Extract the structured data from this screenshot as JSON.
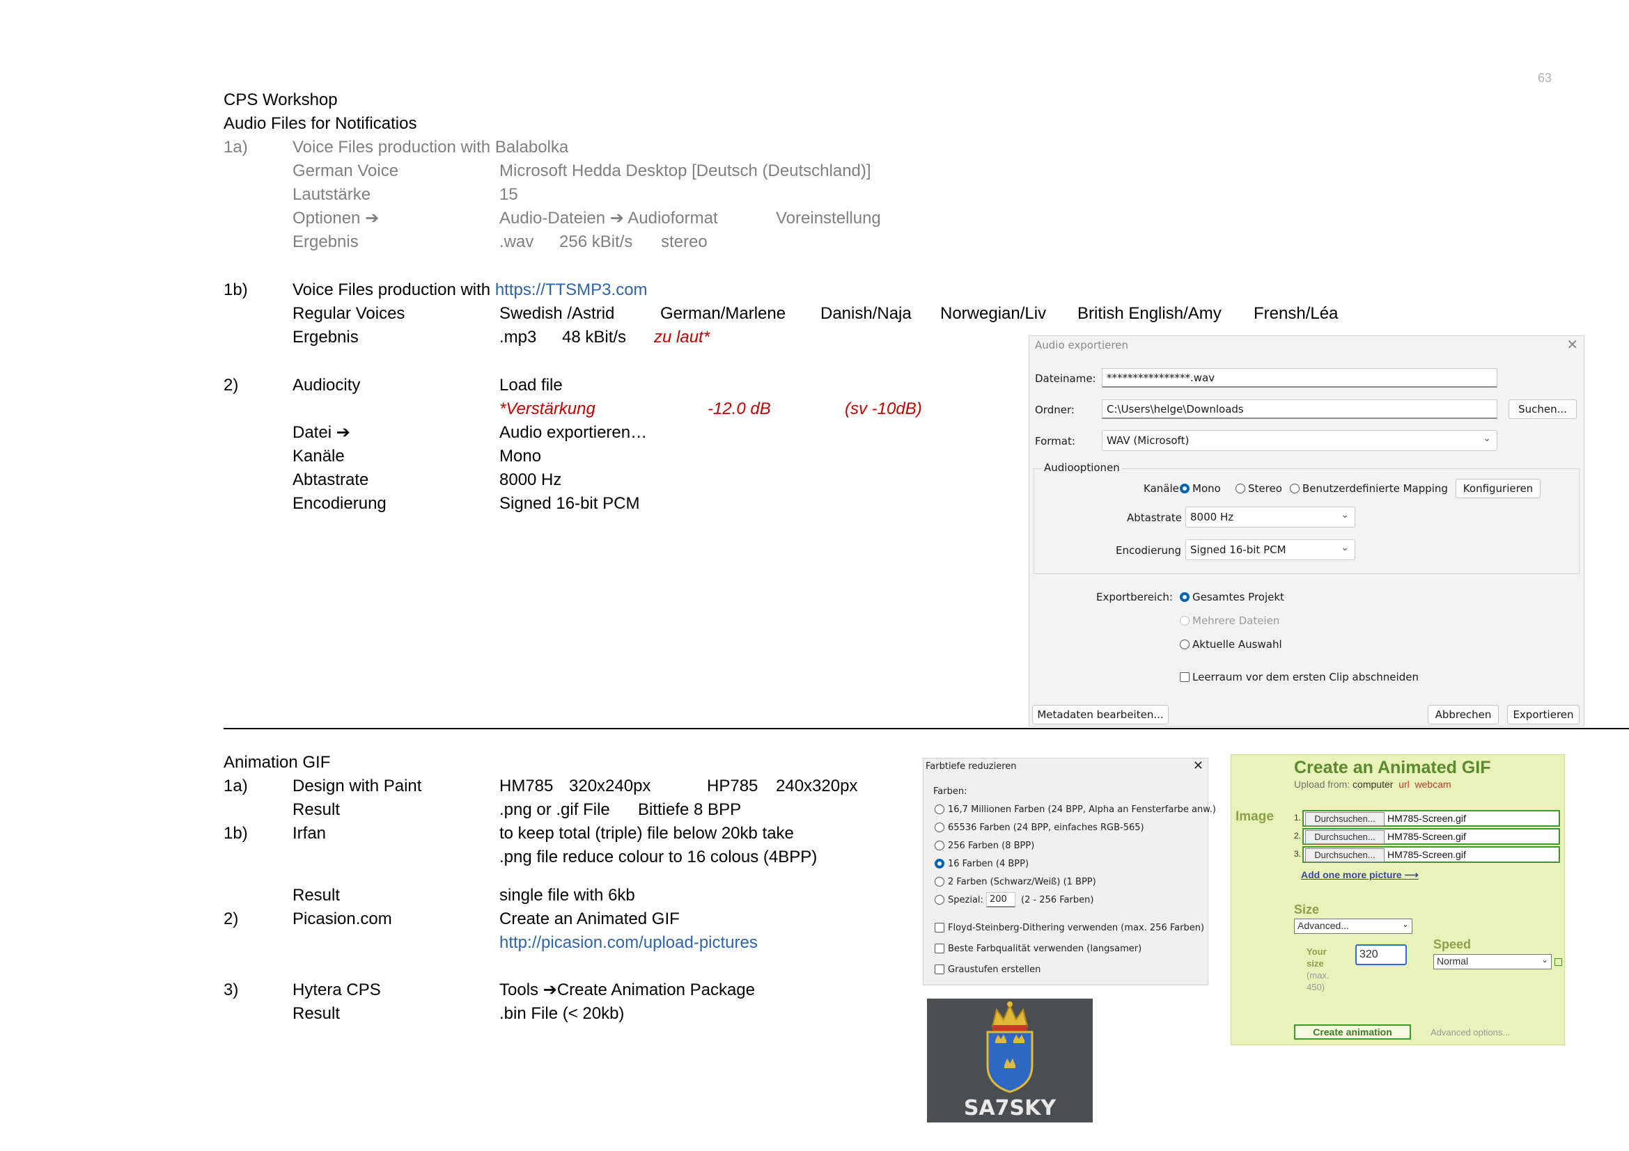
{
  "page_number": "63",
  "header": {
    "title": "CPS Workshop",
    "subtitle": "Audio Files for Notificatios"
  },
  "s1a": {
    "num": "1a)",
    "title": "Voice Files production with Balabolka",
    "german_voice_label": "German Voice",
    "german_voice_value": "Microsoft Hedda Desktop [Deutsch (Deutschland)]",
    "volume_label": "Lautstärke",
    "volume_value": "15",
    "options_label": "Optionen",
    "options_a": "Audio-Dateien",
    "options_b": "Audioformat",
    "options_c": "Voreinstellung",
    "result_label": "Ergebnis",
    "result_a": ".wav",
    "result_b": "256 kBit/s",
    "result_c": "stereo"
  },
  "s1b": {
    "num": "1b)",
    "title_prefix": "Voice Files production with ",
    "link": "https://TTSMP3.com",
    "voices_label": "Regular Voices",
    "voices": [
      "Swedish /Astrid",
      "German/Marlene",
      "Danish/Naja",
      "Norwegian/Liv",
      "British English/Amy",
      "Frensh/Léa"
    ],
    "result_label": "Ergebnis",
    "result_a": ".mp3",
    "result_b": "48 kBit/s",
    "result_note": "zu laut*"
  },
  "s2": {
    "num": "2)",
    "label": "Audiocity",
    "load": "Load file",
    "gain_a": "*Verstärkung",
    "gain_b": "-12.0 dB",
    "gain_c": "(sv -10dB)",
    "file_label": "Datei",
    "file_value": "Audio exportieren…",
    "channels_label": "Kanäle",
    "channels_value": "Mono",
    "rate_label": "Abtastrate",
    "rate_value": "8000 Hz",
    "enc_label": "Encodierung",
    "enc_value": "Signed 16-bit PCM"
  },
  "export_dialog": {
    "title": "Audio exportieren",
    "filename_label": "Dateiname:",
    "filename_value": "****************.wav",
    "folder_label": "Ordner:",
    "folder_value": "C:\\Users\\helge\\Downloads",
    "browse": "Suchen...",
    "format_label": "Format:",
    "format_value": "WAV (Microsoft)",
    "audio_options": "Audiooptionen",
    "channels_label": "Kanäle",
    "mono": "Mono",
    "stereo": "Stereo",
    "custom": "Benutzerdefinierte Mapping",
    "configure": "Konfigurieren",
    "rate_label": "Abtastrate",
    "rate_value": "8000 Hz",
    "enc_label": "Encodierung",
    "enc_value": "Signed 16-bit PCM",
    "range_label": "Exportbereich:",
    "range_all": "Gesamtes Projekt",
    "range_multi": "Mehrere Dateien",
    "range_sel": "Aktuelle Auswahl",
    "trim": "Leerraum vor dem ersten Clip abschneiden",
    "metadata": "Metadaten bearbeiten...",
    "cancel": "Abbrechen",
    "export": "Exportieren"
  },
  "gif": {
    "title": "Animation GIF",
    "r1_num": "1a)",
    "r1_label": "Design with Paint",
    "r1_a": "HM785",
    "r1_b": "320x240px",
    "r1_c": "HP785",
    "r1_d": "240x320px",
    "r2_label": "Result",
    "r2_a": ".png or .gif File",
    "r2_b": "Bittiefe 8 BPP",
    "r3_num": "1b)",
    "r3_label": "Irfan",
    "r3_a": "to keep total (triple) file below 20kb take",
    "r3_b": ".png file reduce colour to 16 colous (4BPP)",
    "r4_label": "Result",
    "r4_a": "single file with 6kb",
    "r5_num": "2)",
    "r5_label": "Picasion.com",
    "r5_a": "Create an Animated GIF",
    "r5_link": "http://picasion.com/upload-pictures",
    "r6_num": "3)",
    "r6_label": "Hytera CPS",
    "r6_a": "Tools",
    "r6_b": "Create Animation Package",
    "r7_label": "Result",
    "r7_a": ".bin File (< 20kb)"
  },
  "farbtiefe": {
    "title": "Farbtiefe reduzieren",
    "colors_label": "Farben:",
    "options": [
      "16,7 Millionen Farben (24 BPP, Alpha an Fensterfarbe anw.)",
      "65536 Farben (24 BPP, einfaches RGB-565)",
      "256 Farben (8 BPP)",
      "16 Farben (4 BPP)",
      "2 Farben (Schwarz/Weiß) (1 BPP)"
    ],
    "special_label": "Spezial:",
    "special_value": "200",
    "special_range": "(2 - 256 Farben)",
    "check1": "Floyd-Steinberg-Dithering verwenden (max. 256 Farben)",
    "check2": "Beste Farbqualität verwenden (langsamer)",
    "check3": "Graustufen erstellen"
  },
  "logo": {
    "callsign": "SA7SKY"
  },
  "picasion": {
    "title": "Create an Animated GIF",
    "upload_from": "Upload from:",
    "src_computer": "computer",
    "src_url": "url",
    "src_webcam": "webcam",
    "image_label": "Image",
    "browse": "Durchsuchen...",
    "files": [
      "HM785-Screen.gif",
      "HM785-Screen.gif",
      "HM785-Screen.gif"
    ],
    "add_more": "Add one more picture",
    "size_label": "Size",
    "size_value": "Advanced...",
    "your_size": "Your size",
    "max": "(max. 450)",
    "size_input": "320",
    "speed_label": "Speed",
    "speed_value": "Normal",
    "create": "Create animation",
    "advanced": "Advanced options..."
  }
}
